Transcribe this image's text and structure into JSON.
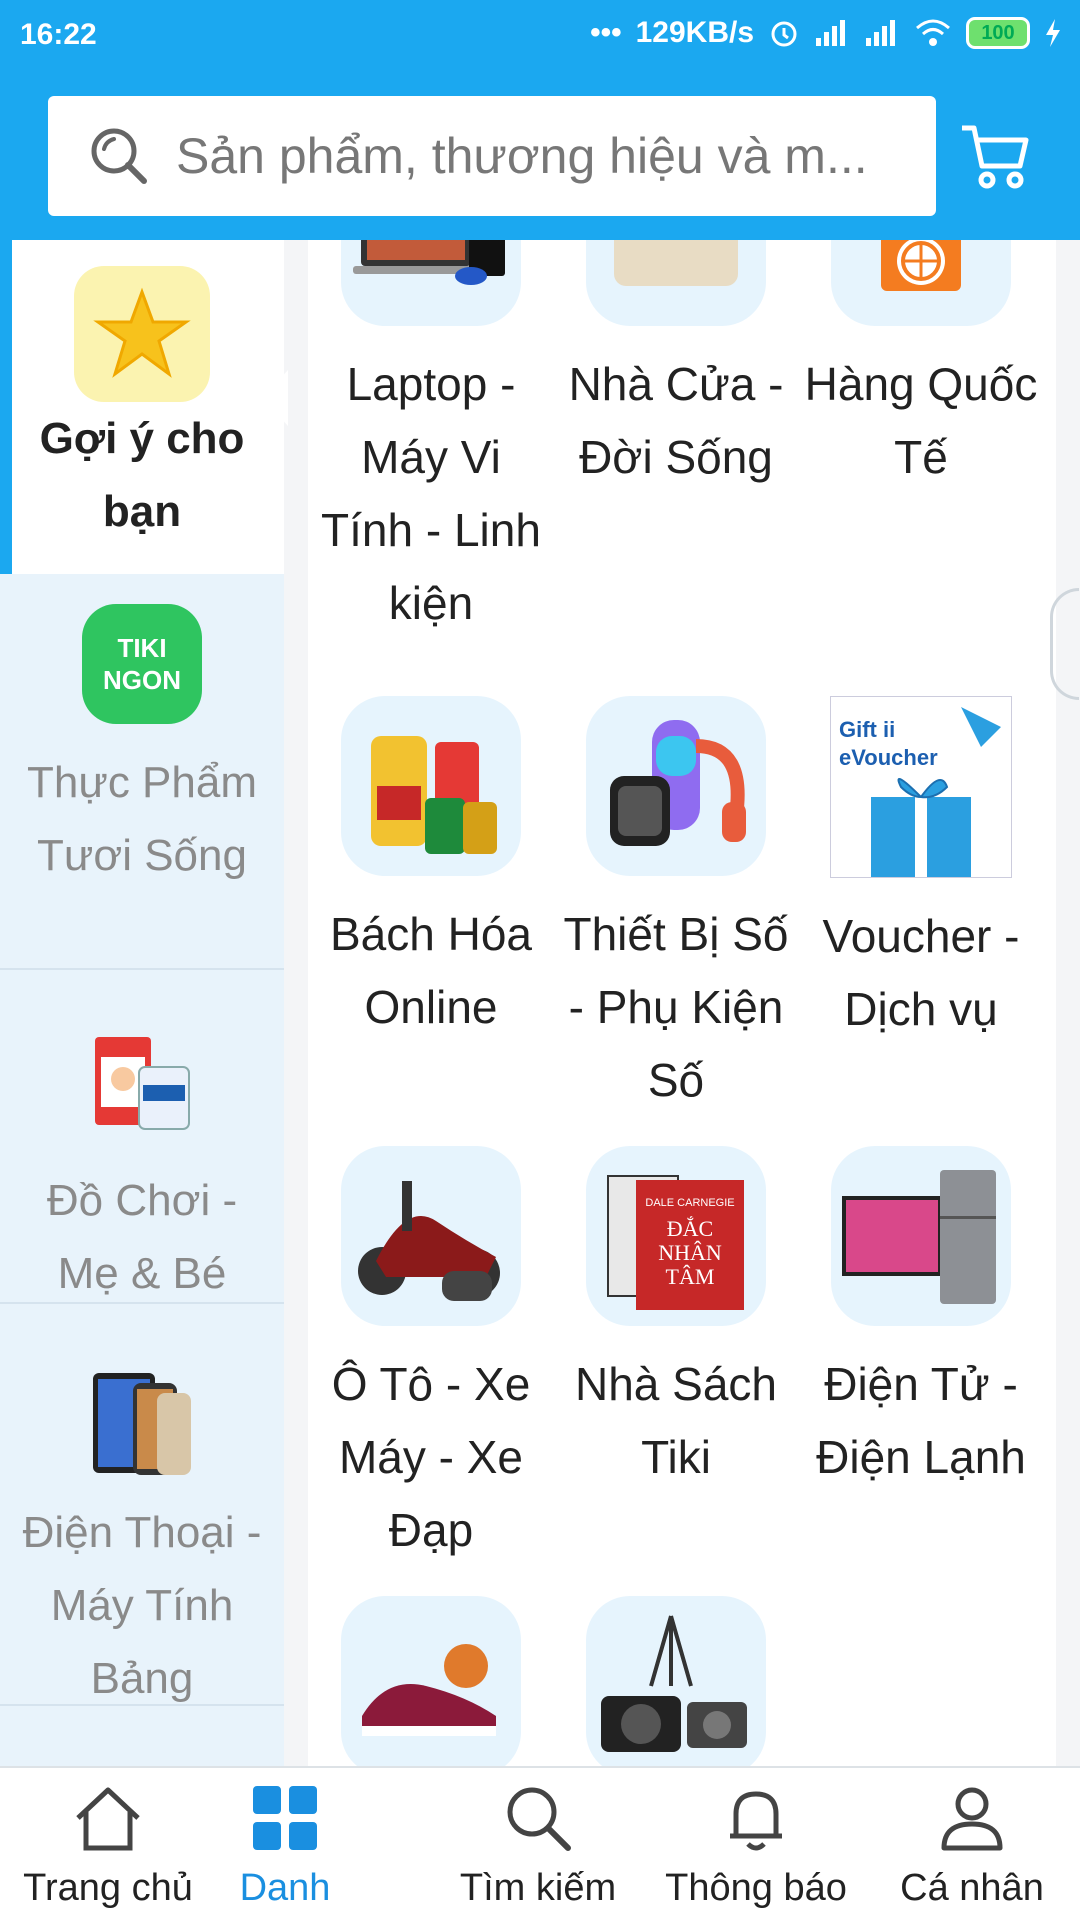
{
  "status_bar": {
    "time": "16:22",
    "network_speed": "129KB/s",
    "battery": "100"
  },
  "search": {
    "placeholder": "Sản phẩm, thương hiệu và m..."
  },
  "sidebar": {
    "items": [
      {
        "label": "Gợi ý cho bạn",
        "icon": "star-icon",
        "active": true
      },
      {
        "label": "Thực Phẩm Tươi Sống",
        "icon": "tiki-ngon-logo",
        "logo_text": "TIKI NGON"
      },
      {
        "label": "Đồ Chơi - Mẹ & Bé",
        "icon": "baby-products-image"
      },
      {
        "label": "Điện Thoại - Máy Tính Bảng",
        "icon": "phones-tablets-image"
      }
    ]
  },
  "categories": [
    {
      "label": "Laptop - Máy Vi Tính - Linh kiện",
      "icon": "laptop-image"
    },
    {
      "label": "Nhà Cửa - Đời Sống",
      "icon": "cooking-pot-image"
    },
    {
      "label": "Hàng Quốc Tế",
      "icon": "international-bag-image"
    },
    {
      "label": "Bách Hóa Online",
      "icon": "grocery-image"
    },
    {
      "label": "Thiết Bị Số - Phụ Kiện Số",
      "icon": "digital-devices-image"
    },
    {
      "label": "Voucher - Dịch vụ",
      "icon": "gift-voucher-image",
      "image_text": "Gift eVoucher"
    },
    {
      "label": "Ô Tô - Xe Máy - Xe Đạp",
      "icon": "motorbike-image"
    },
    {
      "label": "Nhà Sách Tiki",
      "icon": "book-image",
      "image_text": "DALE CARNEGIE ĐẮC NHÂN TÂM"
    },
    {
      "label": "Điện Tử - Điện Lạnh",
      "icon": "tv-fridge-image"
    },
    {
      "label": "",
      "icon": "sneakers-image"
    },
    {
      "label": "",
      "icon": "camera-image"
    }
  ],
  "bottom_nav": [
    {
      "label": "Trang chủ",
      "icon": "home-icon"
    },
    {
      "label": "Danh",
      "icon": "grid-icon",
      "active": true
    },
    {
      "label": "Tìm kiếm",
      "icon": "search-icon"
    },
    {
      "label": "Thông báo",
      "icon": "bell-icon"
    },
    {
      "label": "Cá nhân",
      "icon": "user-icon"
    }
  ],
  "colors": {
    "accent": "#1ba8f0",
    "active_nav": "#1a8fe0"
  }
}
